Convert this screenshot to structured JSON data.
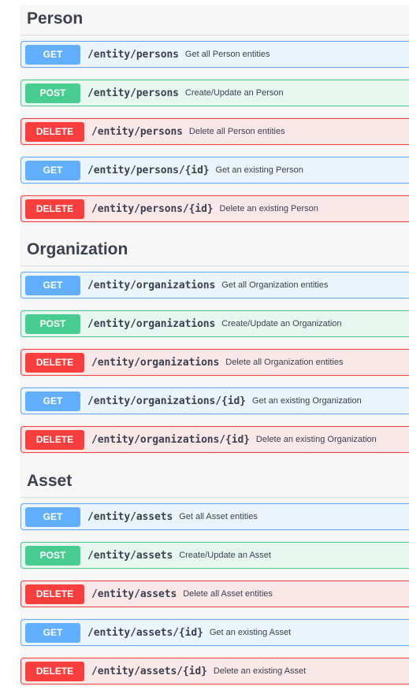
{
  "colors": {
    "get": "#61affe",
    "post": "#49cc90",
    "delete": "#f93e3e",
    "text": "#3b4151"
  },
  "sections": [
    {
      "title": "Person",
      "operations": [
        {
          "method": "GET",
          "path": "/entity/persons",
          "summary": "Get all Person entities"
        },
        {
          "method": "POST",
          "path": "/entity/persons",
          "summary": "Create/Update an Person"
        },
        {
          "method": "DELETE",
          "path": "/entity/persons",
          "summary": "Delete all Person entities"
        },
        {
          "method": "GET",
          "path": "/entity/persons/{id}",
          "summary": "Get an existing Person"
        },
        {
          "method": "DELETE",
          "path": "/entity/persons/{id}",
          "summary": "Delete an existing Person"
        }
      ]
    },
    {
      "title": "Organization",
      "operations": [
        {
          "method": "GET",
          "path": "/entity/organizations",
          "summary": "Get all Organization entities"
        },
        {
          "method": "POST",
          "path": "/entity/organizations",
          "summary": "Create/Update an Organization"
        },
        {
          "method": "DELETE",
          "path": "/entity/organizations",
          "summary": "Delete all Organization entities"
        },
        {
          "method": "GET",
          "path": "/entity/organizations/{id}",
          "summary": "Get an existing Organization"
        },
        {
          "method": "DELETE",
          "path": "/entity/organizations/{id}",
          "summary": "Delete an existing Organization"
        }
      ]
    },
    {
      "title": "Asset",
      "operations": [
        {
          "method": "GET",
          "path": "/entity/assets",
          "summary": "Get all Asset entities"
        },
        {
          "method": "POST",
          "path": "/entity/assets",
          "summary": "Create/Update an Asset"
        },
        {
          "method": "DELETE",
          "path": "/entity/assets",
          "summary": "Delete all Asset entities"
        },
        {
          "method": "GET",
          "path": "/entity/assets/{id}",
          "summary": "Get an existing Asset"
        },
        {
          "method": "DELETE",
          "path": "/entity/assets/{id}",
          "summary": "Delete an existing Asset"
        }
      ]
    }
  ]
}
